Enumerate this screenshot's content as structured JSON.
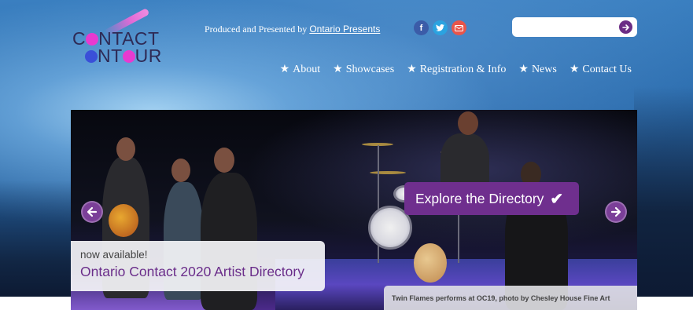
{
  "header": {
    "logo_line1": "C NTACT",
    "logo_line2": " NT UR",
    "produced_prefix": "Produced and Presented by",
    "produced_link": "Ontario Presents"
  },
  "social": [
    {
      "name": "facebook",
      "glyph": "f",
      "color": "#3b5ca8"
    },
    {
      "name": "twitter",
      "glyph": "t",
      "color": "#2ba3e0"
    },
    {
      "name": "email",
      "glyph": "✉",
      "color": "#e8554a"
    }
  ],
  "search": {
    "placeholder": "",
    "button_icon": "arrow-right-circle-icon"
  },
  "nav": [
    {
      "label": "About"
    },
    {
      "label": "Showcases"
    },
    {
      "label": "Registration & Info"
    },
    {
      "label": "News"
    },
    {
      "label": "Contact Us"
    }
  ],
  "slide": {
    "explore_label": "Explore the Directory",
    "caption_small": "now available!",
    "caption_big": "Ontario Contact 2020 Artist Directory",
    "photo_credit": "Twin Flames performs at OC19, photo by Chesley House Fine Art"
  },
  "colors": {
    "accent_purple": "#6f2f8e",
    "logo_pink": "#e83ad0",
    "logo_blue": "#3a4fd8"
  }
}
